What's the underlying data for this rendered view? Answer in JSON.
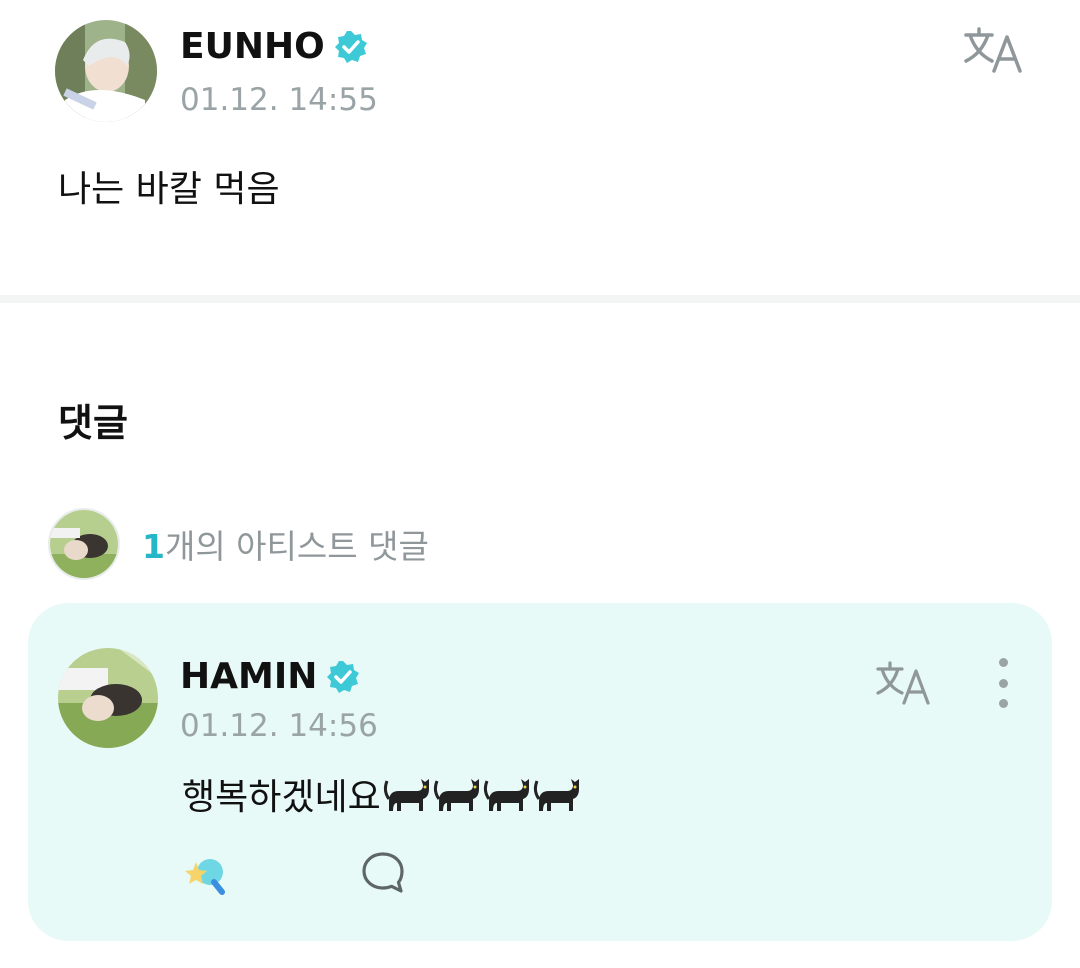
{
  "post": {
    "author": "EUNHO",
    "verified_icon": "verified-badge-icon",
    "timestamp": "01.12. 14:55",
    "body": "나는 바칼 먹음",
    "translate_icon": "translate-icon"
  },
  "comments": {
    "title": "댓글",
    "artist_count_number": "1",
    "artist_count_label": "개의 아티스트 댓글"
  },
  "comment": {
    "author": "HAMIN",
    "timestamp": "01.12. 14:56",
    "body_text": "행복하겠네요",
    "body_emoji": [
      "black-cat",
      "black-cat",
      "black-cat",
      "black-cat"
    ],
    "reaction_icon": "sparkle-reaction-icon",
    "reply_icon": "reply-bubble-icon",
    "more_icon": "more-vertical-icon"
  },
  "colors": {
    "accent": "#25b7c8",
    "verified": "#3ec9d6",
    "card_bg": "#e8faf7",
    "muted_text": "#9aa3a6"
  }
}
